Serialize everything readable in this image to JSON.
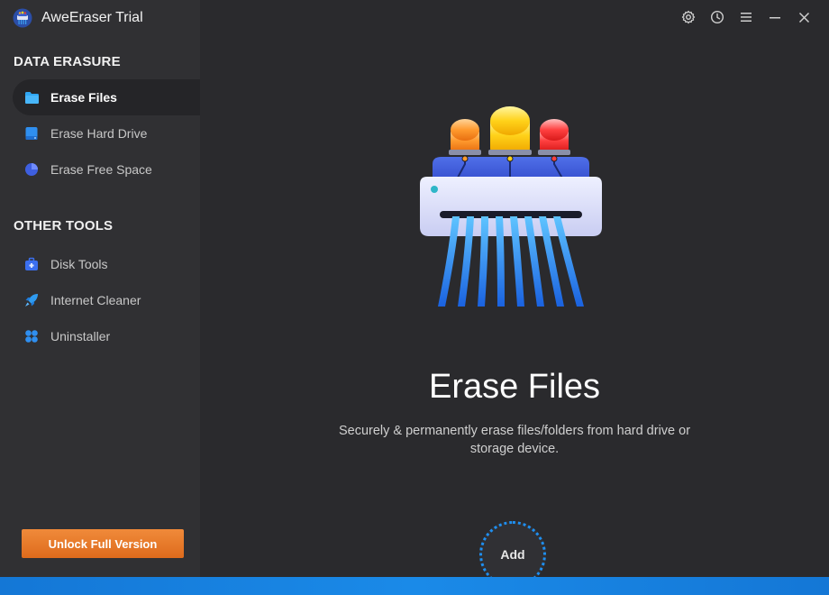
{
  "app": {
    "title": "AweEraser Trial"
  },
  "sidebar": {
    "sections": [
      {
        "title": "DATA ERASURE",
        "items": [
          {
            "label": "Erase Files",
            "icon": "folder-icon",
            "active": true
          },
          {
            "label": "Erase Hard Drive",
            "icon": "hard-drive-icon",
            "active": false
          },
          {
            "label": "Erase Free Space",
            "icon": "pie-chart-icon",
            "active": false
          }
        ]
      },
      {
        "title": "OTHER TOOLS",
        "items": [
          {
            "label": "Disk Tools",
            "icon": "toolbox-icon",
            "active": false
          },
          {
            "label": "Internet Cleaner",
            "icon": "rocket-icon",
            "active": false
          },
          {
            "label": "Uninstaller",
            "icon": "apps-icon",
            "active": false
          }
        ]
      }
    ],
    "unlock_label": "Unlock Full Version"
  },
  "toolbar": {
    "icons": [
      "gear-icon",
      "history-icon",
      "menu-icon",
      "minimize-icon",
      "close-icon"
    ]
  },
  "main": {
    "title": "Erase Files",
    "description": "Securely & permanently erase files/folders from hard drive or storage device.",
    "add_label": "Add"
  },
  "colors": {
    "accent_blue": "#1f8ff0",
    "unlock_orange": "#e9782a",
    "sidebar_bg": "#303033",
    "main_bg": "#2a2a2d"
  }
}
